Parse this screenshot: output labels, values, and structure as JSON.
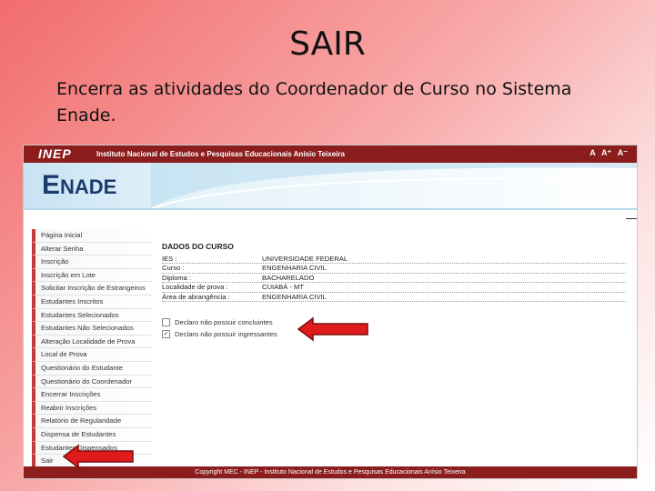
{
  "slide": {
    "title": "SAIR",
    "description": "Encerra as atividades do Coordenador de Curso no Sistema Enade."
  },
  "header": {
    "logo": "INEP",
    "institution": "Instituto Nacional de Estudos e Pesquisas Educacionais Anísio Teixeira",
    "font_tools": [
      "A",
      "A⁺",
      "A⁻"
    ],
    "banner_logo_first": "E",
    "banner_logo_rest": "NADE"
  },
  "menu": [
    "Página Inicial",
    "Alterar Senha",
    "Inscrição",
    "Inscrição em Lote",
    "Solicitar Inscrição de Estrangeiros",
    "Estudantes Inscritos",
    "Estudantes Selecionados",
    "Estudantes Não Selecionados",
    "Alteração Localidade de Prova",
    "Local de Prova",
    "Questionário do Estudante",
    "Questionário do Coordenador",
    "Encerrar Inscrições",
    "Reabrir Inscrições",
    "Relatório de Regularidade",
    "Dispensa de Estudantes",
    "Estudantes Dispensados",
    "Sair"
  ],
  "course": {
    "title": "DADOS DO CURSO",
    "rows": [
      {
        "label": "IES :",
        "value": "UNIVERSIDADE FEDERAL"
      },
      {
        "label": "Curso :",
        "value": "ENGENHARIA CIVIL"
      },
      {
        "label": "Diploma :",
        "value": "BACHARELADO"
      },
      {
        "label": "Localidade de prova :",
        "value": "CUIABÁ - MT"
      },
      {
        "label": "Área de abrangência :",
        "value": "ENGENHARIA CIVIL"
      }
    ]
  },
  "checks": [
    {
      "label": "Declaro não possuir concluintes",
      "checked": false
    },
    {
      "label": "Declaro não possuir ingressantes",
      "checked": true
    }
  ],
  "footer": "Copyright MEC - INEP - Instituto Nacional de Estudos e Pesquisas Educacionais Anísio Teixeira",
  "colors": {
    "header_red": "#8c1d1d",
    "arrow_red": "#e11b1b",
    "banner_blue": "#c8e3f3",
    "logo_blue": "#1b3a6e"
  }
}
